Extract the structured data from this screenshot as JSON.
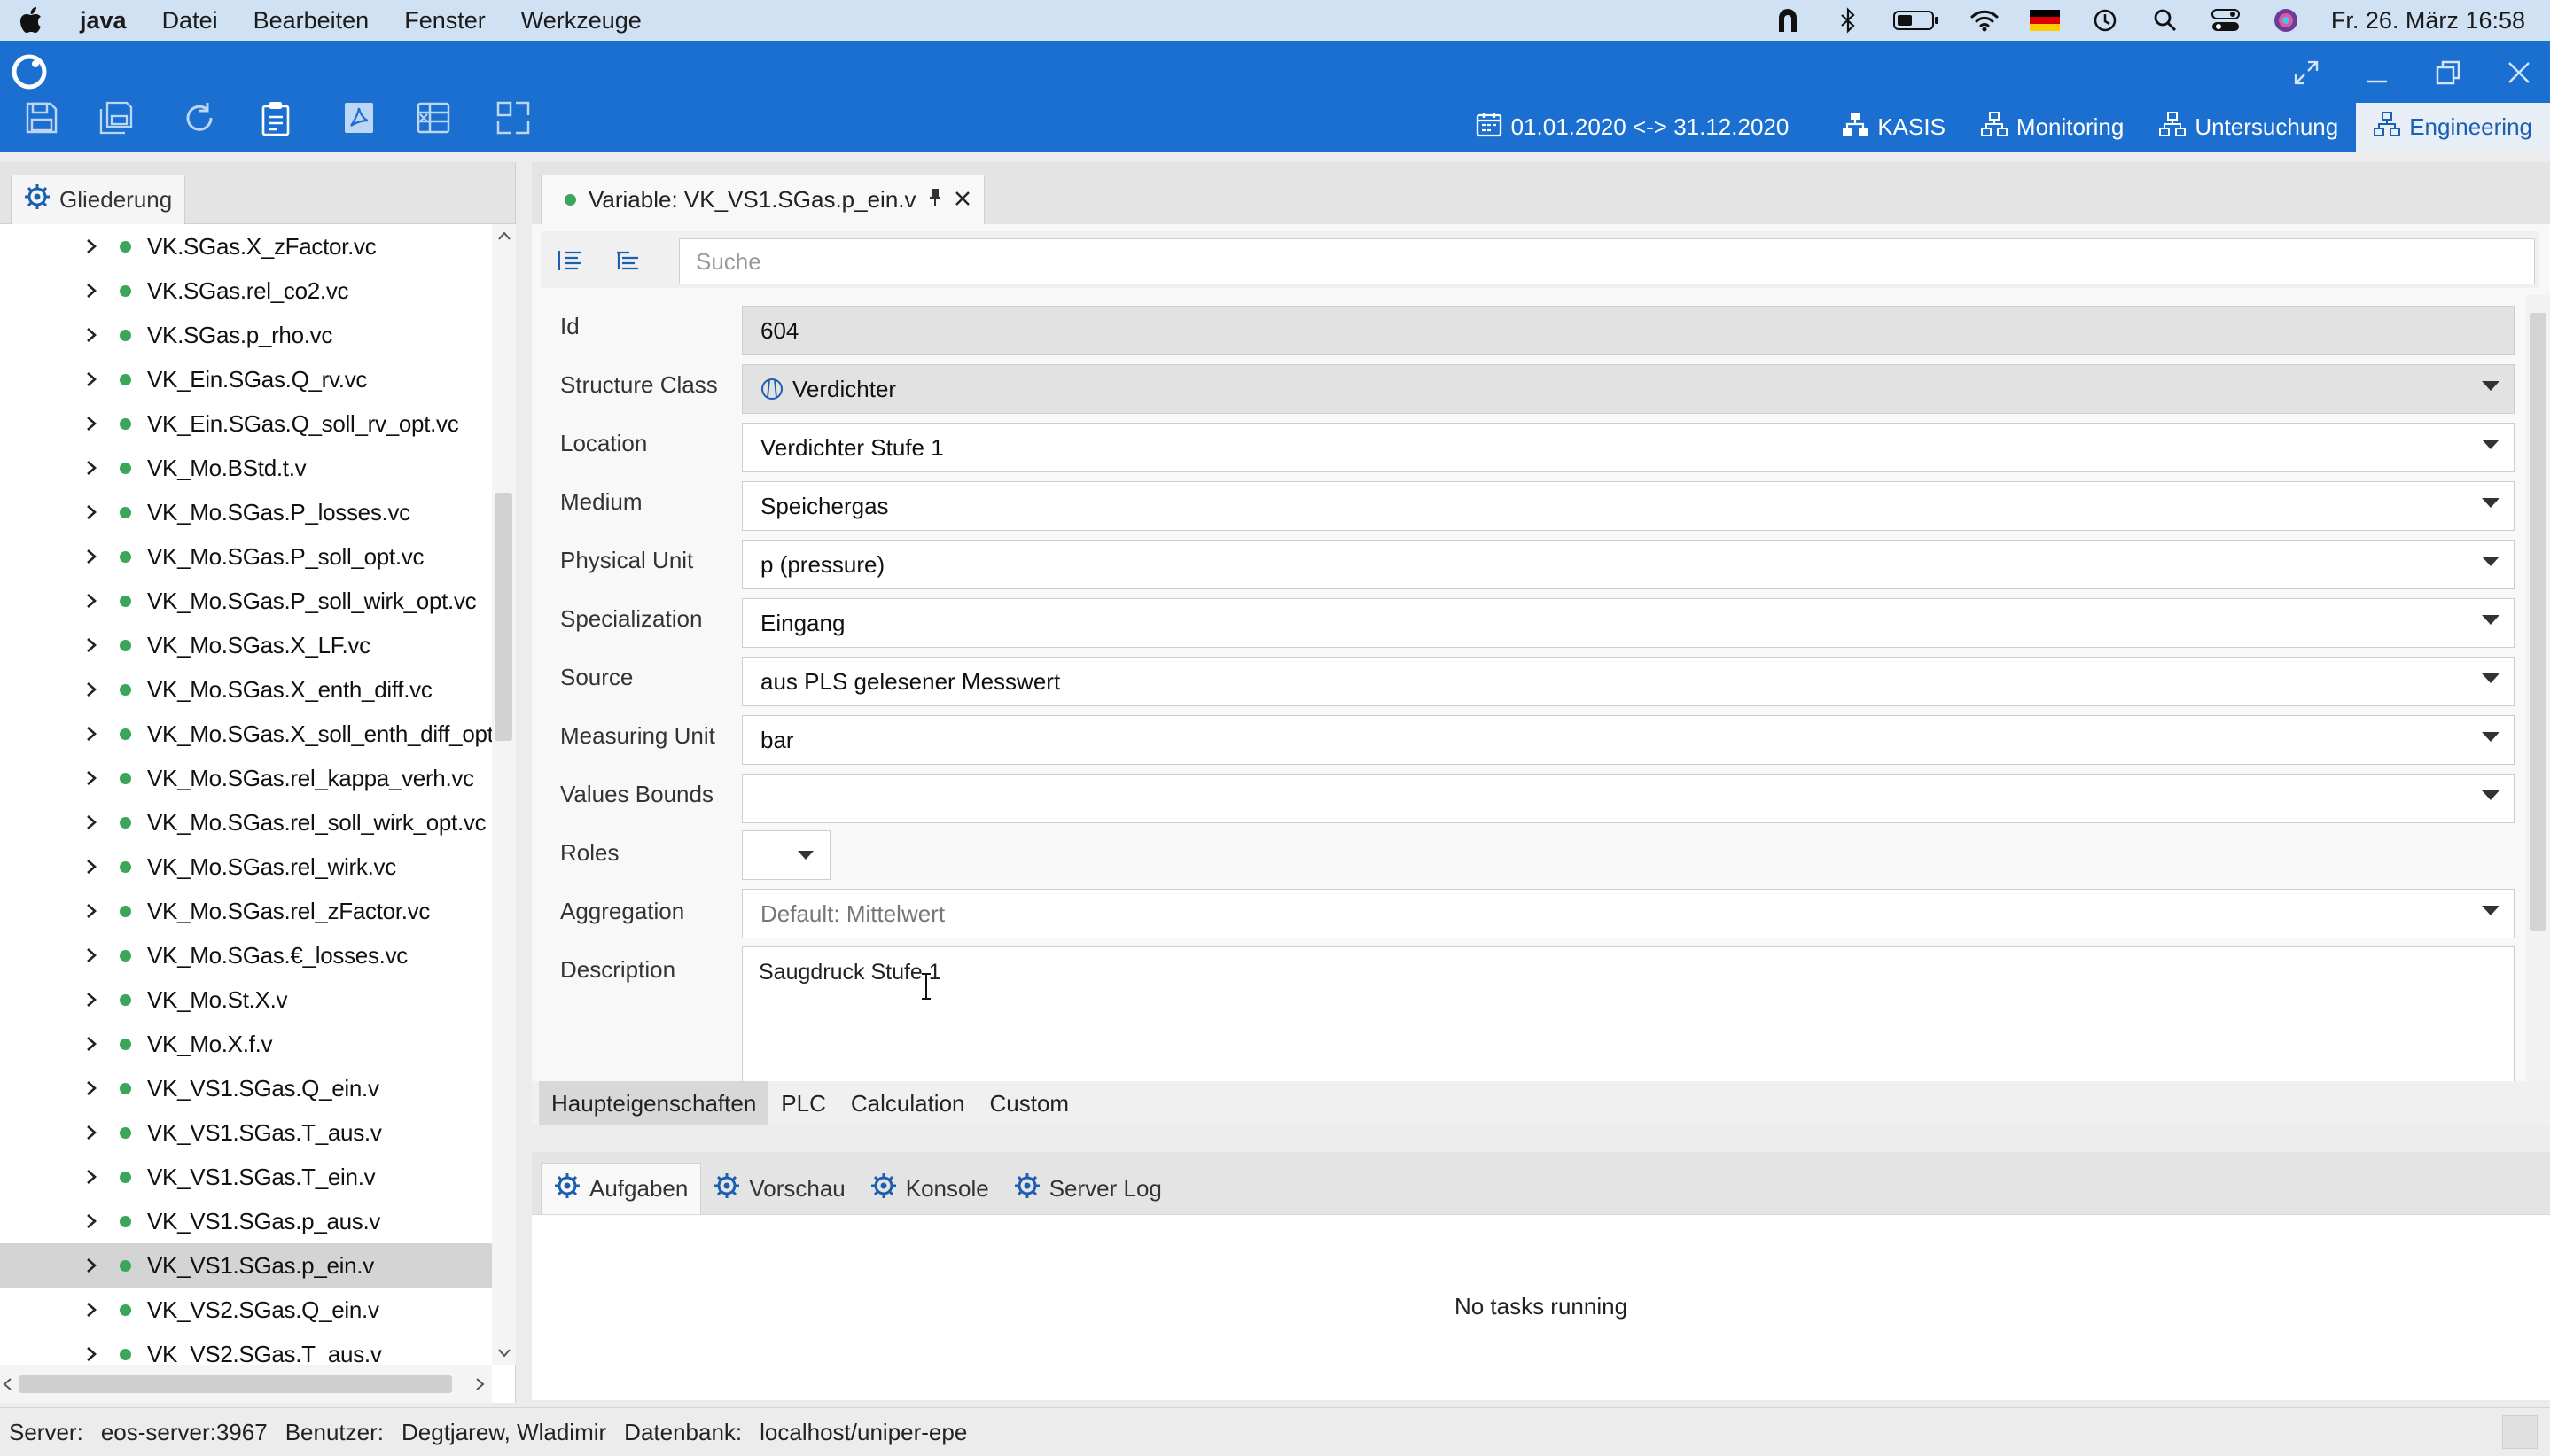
{
  "menubar": {
    "app_name": "java",
    "menus": [
      "Datei",
      "Bearbeiten",
      "Fenster",
      "Werkzeuge"
    ],
    "clock": "Fr. 26. März  16:58"
  },
  "toolbar": {
    "date_range": "01.01.2020 <-> 31.12.2020",
    "perspectives": [
      "KASIS",
      "Monitoring",
      "Untersuchung",
      "Engineering"
    ],
    "active_perspective": "Engineering"
  },
  "outline": {
    "tab_label": "Gliederung",
    "items": [
      "VK.SGas.X_zFactor.vc",
      "VK.SGas.rel_co2.vc",
      "VK.SGas.p_rho.vc",
      "VK_Ein.SGas.Q_rv.vc",
      "VK_Ein.SGas.Q_soll_rv_opt.vc",
      "VK_Mo.BStd.t.v",
      "VK_Mo.SGas.P_losses.vc",
      "VK_Mo.SGas.P_soll_opt.vc",
      "VK_Mo.SGas.P_soll_wirk_opt.vc",
      "VK_Mo.SGas.X_LF.vc",
      "VK_Mo.SGas.X_enth_diff.vc",
      "VK_Mo.SGas.X_soll_enth_diff_opt.",
      "VK_Mo.SGas.rel_kappa_verh.vc",
      "VK_Mo.SGas.rel_soll_wirk_opt.vc",
      "VK_Mo.SGas.rel_wirk.vc",
      "VK_Mo.SGas.rel_zFactor.vc",
      "VK_Mo.SGas.€_losses.vc",
      "VK_Mo.St.X.v",
      "VK_Mo.X.f.v",
      "VK_VS1.SGas.Q_ein.v",
      "VK_VS1.SGas.T_aus.v",
      "VK_VS1.SGas.T_ein.v",
      "VK_VS1.SGas.p_aus.v",
      "VK_VS1.SGas.p_ein.v",
      "VK_VS2.SGas.Q_ein.v",
      "VK_VS2.SGas.T_aus.v"
    ],
    "selected_item": "VK_VS1.SGas.p_ein.v"
  },
  "editor": {
    "tab_title": "Variable: VK_VS1.SGas.p_ein.v",
    "search_placeholder": "Suche",
    "fields": {
      "id": {
        "label": "Id",
        "value": "604"
      },
      "structure_class": {
        "label": "Structure Class",
        "value": "Verdichter"
      },
      "location": {
        "label": "Location",
        "value": "Verdichter Stufe 1"
      },
      "medium": {
        "label": "Medium",
        "value": "Speichergas"
      },
      "physical_unit": {
        "label": "Physical Unit",
        "value": "p (pressure)"
      },
      "specialization": {
        "label": "Specialization",
        "value": "Eingang"
      },
      "source": {
        "label": "Source",
        "value": "aus PLS gelesener Messwert"
      },
      "measuring_unit": {
        "label": "Measuring Unit",
        "value": "bar"
      },
      "values_bounds": {
        "label": "Values Bounds",
        "value": ""
      },
      "roles": {
        "label": "Roles",
        "value": ""
      },
      "aggregation": {
        "label": "Aggregation",
        "value": "Default: Mittelwert"
      },
      "description": {
        "label": "Description",
        "value": "Saugdruck Stufe 1"
      }
    },
    "property_tabs": [
      "Haupteigenschaften",
      "PLC",
      "Calculation",
      "Custom"
    ],
    "active_property_tab": "Haupteigenschaften"
  },
  "bottom_panel": {
    "tabs": [
      "Aufgaben",
      "Vorschau",
      "Konsole",
      "Server Log"
    ],
    "active_tab": "Aufgaben",
    "message": "No tasks running"
  },
  "statusbar": {
    "server_label": "Server:",
    "server": "eos-server:3967",
    "user_label": "Benutzer:",
    "user": "Degtjarew, Wladimir",
    "db_label": "Datenbank:",
    "db": "localhost/uniper-epe"
  },
  "colors": {
    "toolbar_blue": "#1a6fd0",
    "menubar": "#cfe1f3",
    "status_dot": "#3ba55c"
  }
}
